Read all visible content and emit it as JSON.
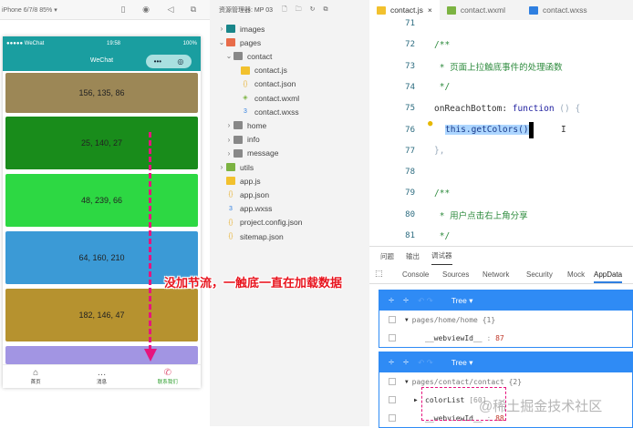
{
  "simulator": {
    "device_label": "iPhone 6/7/8 85% ▾",
    "status": {
      "carrier": "●●●●● WeChat",
      "time": "19:58",
      "battery": "100%"
    },
    "nav_title": "WeChat",
    "capsule": {
      "more": "•••",
      "close": "◎"
    },
    "color_blocks": [
      {
        "label": "156, 135, 86",
        "color": "#9c8756"
      },
      {
        "label": "25, 140, 27",
        "color": "#198c1b"
      },
      {
        "label": "48, 239, 66",
        "color": "#2dd843"
      },
      {
        "label": "64, 160, 210",
        "color": "#3b9ad6"
      },
      {
        "label": "182, 146, 47",
        "color": "#b6922f"
      },
      {
        "label": "",
        "color": "#a295e3"
      }
    ],
    "tabbar": [
      {
        "icon": "⌂",
        "label": "首页"
      },
      {
        "icon": "…",
        "label": "消息"
      },
      {
        "icon": "✆",
        "label": "联系我们"
      }
    ]
  },
  "explorer": {
    "title": "资源管理器: MP 03",
    "items": [
      {
        "label": "images",
        "type": "folder",
        "chev": "›",
        "color": "#19868a"
      },
      {
        "label": "pages",
        "type": "folder",
        "chev": "⌄",
        "color": "#e86c4a"
      },
      {
        "label": "contact",
        "type": "folder",
        "chev": "⌄",
        "color": "#888"
      },
      {
        "label": "contact.js",
        "type": "js",
        "color": "#f2c12e"
      },
      {
        "label": "contact.json",
        "type": "json",
        "color": "#e7b43a"
      },
      {
        "label": "contact.wxml",
        "type": "wxml",
        "color": "#7cb342"
      },
      {
        "label": "contact.wxss",
        "type": "wxss",
        "color": "#2f7fe0"
      },
      {
        "label": "home",
        "type": "folder",
        "chev": "›",
        "color": "#888"
      },
      {
        "label": "info",
        "type": "folder",
        "chev": "›",
        "color": "#888"
      },
      {
        "label": "message",
        "type": "folder",
        "chev": "›",
        "color": "#888"
      },
      {
        "label": "utils",
        "type": "folder",
        "chev": "›",
        "color": "#7cb342"
      },
      {
        "label": "app.js",
        "type": "js",
        "color": "#f2c12e"
      },
      {
        "label": "app.json",
        "type": "json",
        "color": "#e7b43a"
      },
      {
        "label": "app.wxss",
        "type": "wxss",
        "color": "#2f7fe0"
      },
      {
        "label": "project.config.json",
        "type": "json",
        "color": "#e7b43a"
      },
      {
        "label": "sitemap.json",
        "type": "json",
        "color": "#e7b43a"
      }
    ]
  },
  "editor": {
    "tabs": [
      {
        "label": "contact.js",
        "close": "×"
      },
      {
        "label": "contact.wxml"
      },
      {
        "label": "contact.wxss"
      }
    ],
    "lines": [
      {
        "n": "71",
        "text": ""
      },
      {
        "n": "72",
        "text": "/**"
      },
      {
        "n": "73",
        "text": " * 页面上拉触底事件的处理函数"
      },
      {
        "n": "74",
        "text": " */"
      },
      {
        "n": "75",
        "text": "onReachBottom: function () {"
      },
      {
        "n": "76",
        "text": "  this.getColors()"
      },
      {
        "n": "77",
        "text": "},"
      },
      {
        "n": "78",
        "text": ""
      },
      {
        "n": "79",
        "text": "/**"
      },
      {
        "n": "80",
        "text": " * 用户点击右上角分享"
      },
      {
        "n": "81",
        "text": " */"
      }
    ]
  },
  "devtools": {
    "top_tabs": [
      "问题",
      "输出",
      "调试器"
    ],
    "tabs": [
      "Console",
      "Sources",
      "Network",
      "Security",
      "Mock",
      "AppData"
    ],
    "panels": [
      {
        "mode": "Tree ▾",
        "path": "pages/home/home {1}",
        "rows": [
          {
            "key": "__webviewId__",
            "sep": " : ",
            "value": "87"
          }
        ]
      },
      {
        "mode": "Tree ▾",
        "path": "pages/contact/contact {2}",
        "rows": [
          {
            "key": "colorList",
            "sep": " ",
            "value": "[60]"
          },
          {
            "key": "__webviewId__",
            "sep": " : ",
            "value": "88"
          }
        ]
      }
    ]
  },
  "annotation": "没加节流，一触底一直在加载数据",
  "watermark": "@稀土掘金技术社区"
}
